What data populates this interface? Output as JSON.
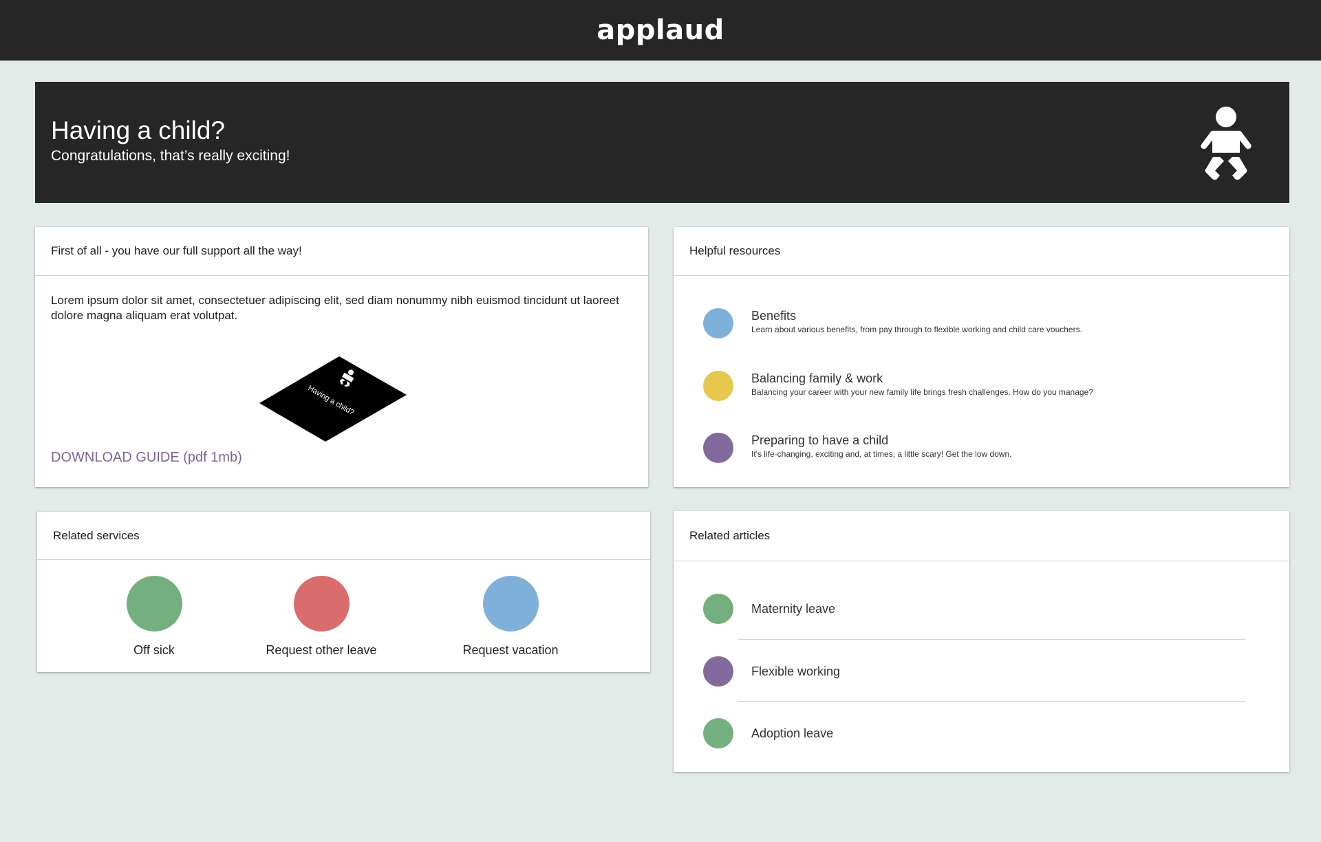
{
  "header": {
    "logo": "applaud"
  },
  "hero": {
    "title": "Having a child?",
    "subtitle": "Congratulations, that’s really exciting!",
    "icon": "baby-icon"
  },
  "support": {
    "heading": "First of all - you have our full support all the way!",
    "body": "Lorem ipsum dolor sit amet, consectetuer adipiscing elit, sed diam nonummy nibh euismod tincidunt ut laoreet dolore magna aliquam erat volutpat.",
    "guide_label": "Having a child?",
    "download": "DOWNLOAD GUIDE (pdf 1mb)"
  },
  "resources": {
    "heading": "Helpful resources",
    "items": [
      {
        "title": "Benefits",
        "desc": "Learn about various benefits, from pay through to flexible working and child care vouchers.",
        "color": "#7fb0d9"
      },
      {
        "title": "Balancing family & work",
        "desc": "Balancing your career with your new family life brings fresh challenges. How do you manage?",
        "color": "#e6c84f"
      },
      {
        "title": "Preparing to have a child",
        "desc": "It's life-changing, exciting and, at times, a little scary! Get the low down.",
        "color": "#846a9c"
      }
    ]
  },
  "services": {
    "heading": "Related services",
    "items": [
      {
        "label": "Off sick",
        "color": "#74b07f"
      },
      {
        "label": "Request other leave",
        "color": "#d96d6d"
      },
      {
        "label": "Request vacation",
        "color": "#7fb0d9"
      }
    ]
  },
  "articles": {
    "heading": "Related articles",
    "items": [
      {
        "label": "Maternity leave",
        "color": "#74b07f"
      },
      {
        "label": "Flexible working",
        "color": "#846a9c"
      },
      {
        "label": "Adoption leave",
        "color": "#74b07f"
      }
    ]
  }
}
